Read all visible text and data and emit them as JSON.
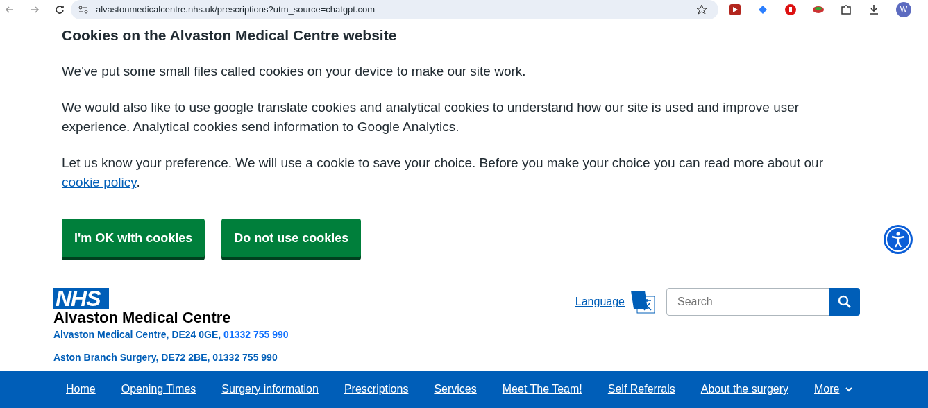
{
  "browser": {
    "url": "alvastonmedicalcentre.nhs.uk/prescriptions?utm_source=chatgpt.com",
    "avatar": "W"
  },
  "cookie_banner": {
    "title": "Cookies on the Alvaston Medical Centre website",
    "paragraphs": [
      "We've put some small files called cookies on your device to make our site work.",
      "We would also like to use google translate cookies and analytical cookies to understand how our site is used and improve user experience. Analytical cookies send information to Google Analytics."
    ],
    "preference_text": "Let us know your preference. We will use a cookie to save your choice. Before you make your choice you can read more about our ",
    "policy_link": "cookie policy",
    "after_link": ".",
    "buttons": [
      "I'm OK with cookies",
      "Do not use cookies"
    ]
  },
  "header": {
    "logo": "NHS",
    "name": "Alvaston Medical Centre",
    "addresses": [
      {
        "text": "Alvaston Medical Centre, DE24 0GE, ",
        "phone": "01332 755 990",
        "phone_link": true
      },
      {
        "text": "Aston Branch Surgery, DE72 2BE, ",
        "phone": "01332 755 990",
        "phone_link": false
      }
    ],
    "language": "Language",
    "search": {
      "placeholder": "Search"
    }
  },
  "nav": [
    {
      "label": "Home",
      "kind": "link"
    },
    {
      "label": "Opening Times",
      "kind": "link"
    },
    {
      "label": "Surgery information",
      "kind": "link"
    },
    {
      "label": "Prescriptions",
      "kind": "link"
    },
    {
      "label": "Services",
      "kind": "link"
    },
    {
      "label": "Meet The Team!",
      "kind": "link"
    },
    {
      "label": "Self Referrals",
      "kind": "link"
    },
    {
      "label": "About the surgery",
      "kind": "link"
    },
    {
      "label": "More",
      "kind": "dropdown"
    }
  ]
}
